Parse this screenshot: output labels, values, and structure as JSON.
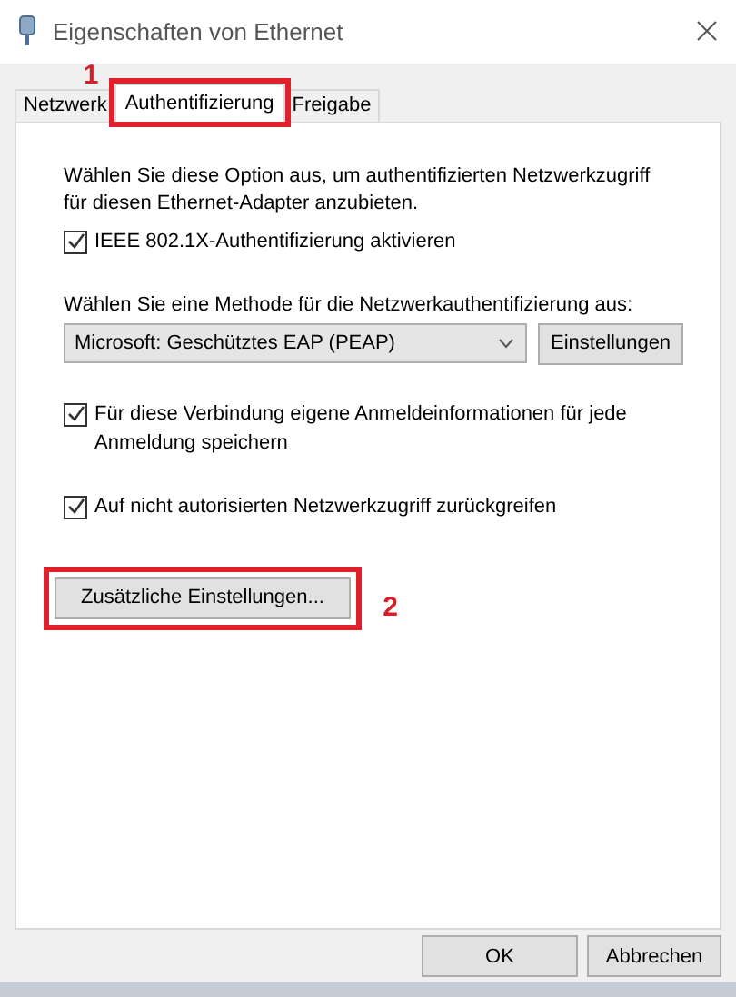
{
  "window": {
    "title": "Eigenschaften von Ethernet"
  },
  "tabs": [
    {
      "label": "Netzwerk",
      "selected": false
    },
    {
      "label": "Authentifizierung",
      "selected": true,
      "marker": "1"
    },
    {
      "label": "Freigabe",
      "selected": false
    }
  ],
  "panel": {
    "intro": "Wählen Sie diese Option aus, um authentifizierten Netzwerkzugriff für diesen Ethernet-Adapter anzubieten.",
    "enable_checkbox": {
      "label": "IEEE 802.1X-Authentifizierung aktivieren",
      "checked": true
    },
    "method_label": "Wählen Sie eine Methode für die Netzwerkauthentifizierung aus:",
    "method_dropdown": {
      "value": "Microsoft: Geschütztes EAP (PEAP)"
    },
    "settings_button": "Einstellungen",
    "options": [
      {
        "label": "Für diese Verbindung eigene Anmeldeinformationen für jede Anmeldung speichern",
        "checked": true
      },
      {
        "label": "Auf nicht autorisierten Netzwerkzugriff zurückgreifen",
        "checked": true
      }
    ],
    "additional_button": {
      "label": "Zusätzliche Einstellungen...",
      "marker": "2"
    }
  },
  "buttons": [
    "OK",
    "Abbrechen"
  ]
}
